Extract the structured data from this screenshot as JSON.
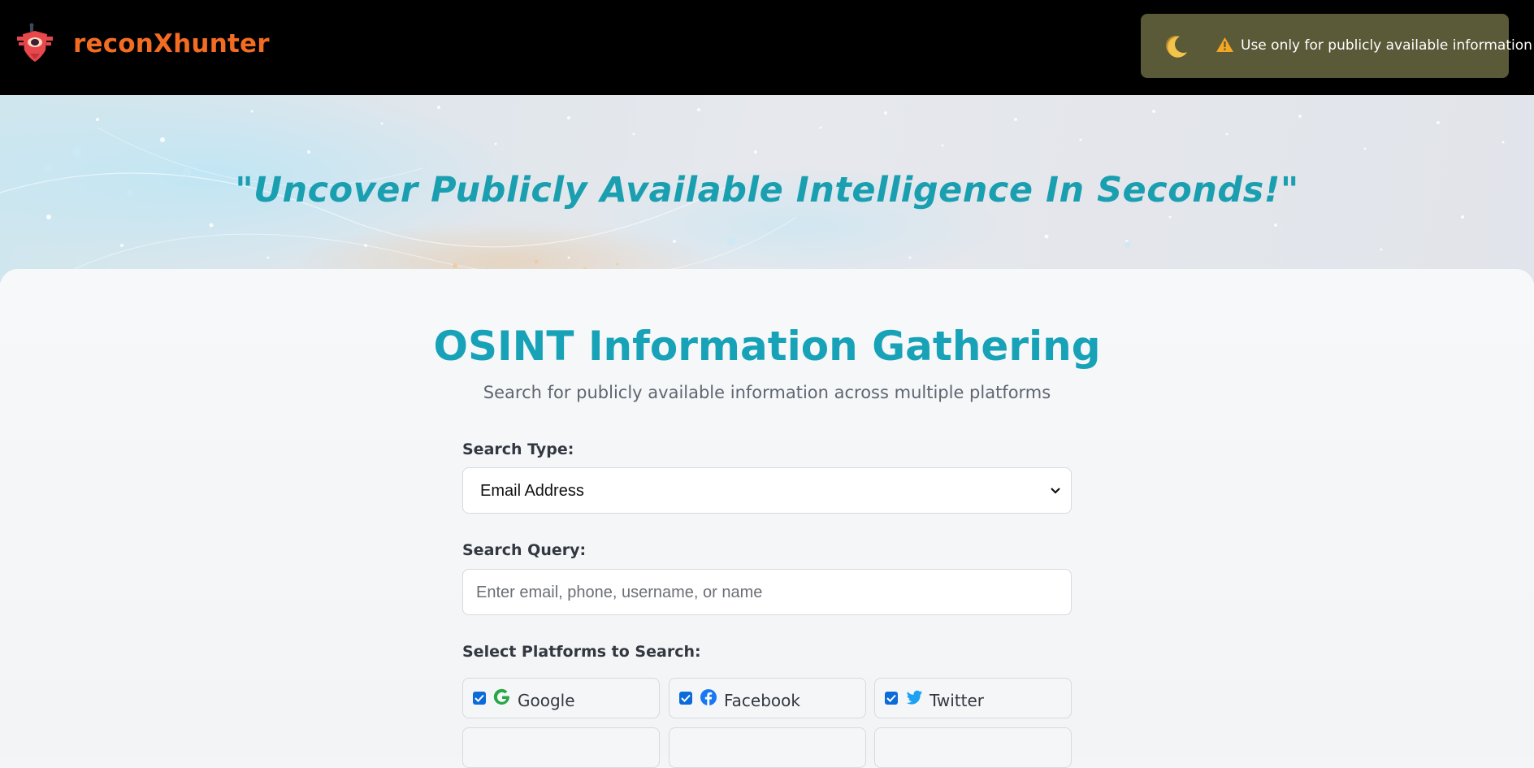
{
  "header": {
    "brand_name": "reconXhunter",
    "logo_icon": "shield-robot-logo",
    "theme_toggle_icon": "crescent-moon-icon",
    "warning_icon": "warning-triangle-icon",
    "notice_text": "Use only for publicly available information",
    "brand_color": "#f26c22"
  },
  "hero": {
    "quote": "\"Uncover Publicly Available Intelligence In Seconds!\""
  },
  "main": {
    "title": "OSINT Information Gathering",
    "subtitle": "Search for publicly available information across multiple platforms",
    "accent_color": "#17a2b8",
    "search_type": {
      "label": "Search Type:",
      "selected": "Email Address"
    },
    "search_query": {
      "label": "Search Query:",
      "placeholder": "Enter email, phone, username, or name",
      "value": ""
    },
    "platforms": {
      "label": "Select Platforms to Search:",
      "items": [
        {
          "label": "Google",
          "icon": "google-icon",
          "checked": true,
          "color": "#28a745"
        },
        {
          "label": "Facebook",
          "icon": "facebook-icon",
          "checked": true,
          "color": "#1877f2"
        },
        {
          "label": "Twitter",
          "icon": "twitter-icon",
          "checked": true,
          "color": "#1da1f2"
        }
      ]
    }
  }
}
